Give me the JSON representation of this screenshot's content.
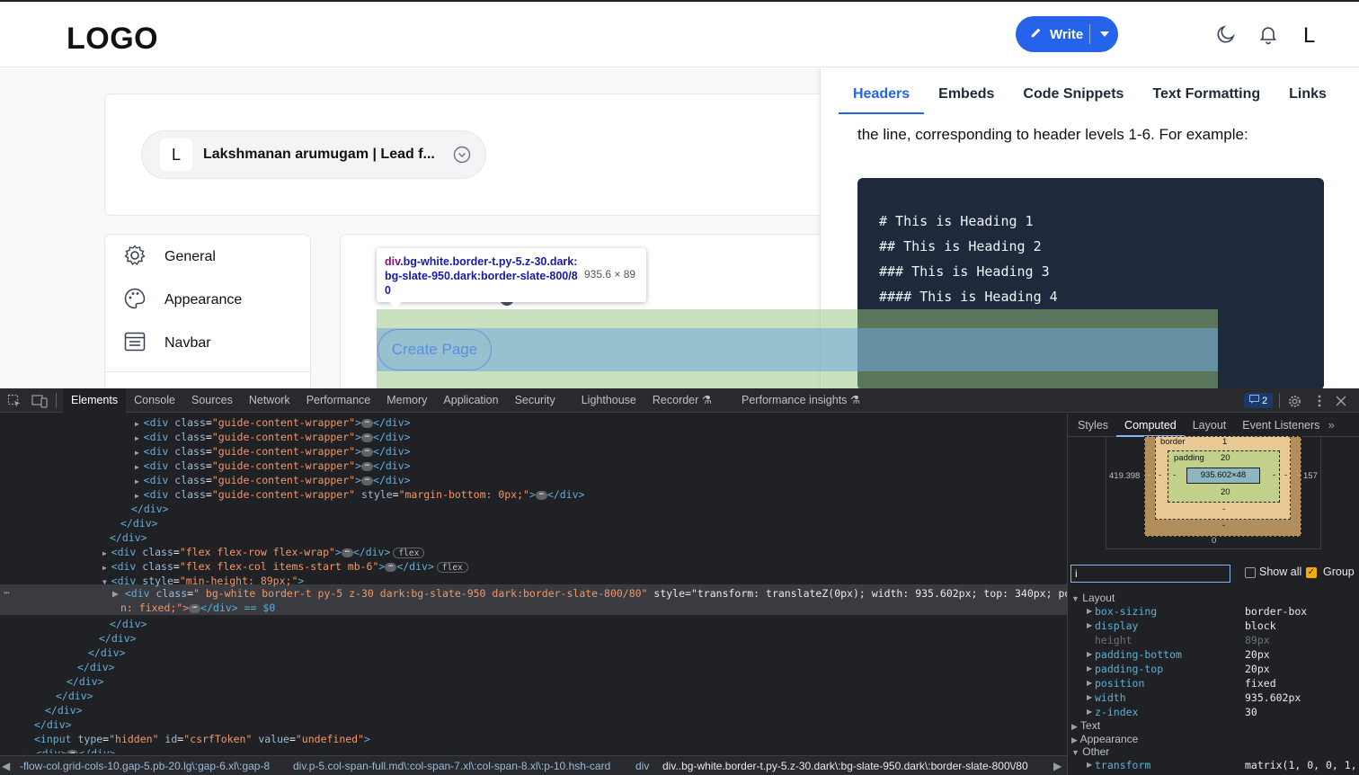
{
  "header": {
    "logo": "LOGO",
    "write_label": "Write",
    "avatar_letter": "L",
    "icons": [
      "pencil-icon",
      "caret-down-icon",
      "moon-icon",
      "bell-icon"
    ]
  },
  "profile": {
    "avatar_letter": "L",
    "name": "Lakshmanan arumugam | Lead f..."
  },
  "settings_nav": {
    "items": [
      {
        "label": "General",
        "icon": "gear-icon"
      },
      {
        "label": "Appearance",
        "icon": "palette-icon"
      },
      {
        "label": "Navbar",
        "icon": "navbar-icon"
      }
    ]
  },
  "guide": {
    "tabs": [
      "Headers",
      "Embeds",
      "Code Snippets",
      "Text Formatting",
      "Links"
    ],
    "active_tab": "Headers",
    "text": "the line, corresponding to header levels 1-6. For example:",
    "code_lines": [
      "# This is Heading 1",
      "## This is Heading 2",
      "### This is Heading 3",
      "#### This is Heading 4"
    ]
  },
  "inspect": {
    "create_page_label": "Create Page",
    "tooltip_tag": "div",
    "tooltip_classes": ".bg-white.border-t.py-5.z-30.dark:bg-slate-950.dark:border-slate-800/80",
    "tooltip_dims": "935.6 × 89"
  },
  "devtools": {
    "tabs": [
      "Elements",
      "Console",
      "Sources",
      "Network",
      "Performance",
      "Memory",
      "Application",
      "Security",
      "Lighthouse",
      "Recorder",
      "Performance insights"
    ],
    "active_tab": "Elements",
    "issues_count": "2",
    "dom_lines": [
      {
        "ind": 150,
        "tri": "▶",
        "html": "<div class=\"guide-content-wrapper\">",
        "ell": true,
        "close": "</div>"
      },
      {
        "ind": 150,
        "tri": "▶",
        "html": "<div class=\"guide-content-wrapper\">",
        "ell": true,
        "close": "</div>"
      },
      {
        "ind": 150,
        "tri": "▶",
        "html": "<div class=\"guide-content-wrapper\">",
        "ell": true,
        "close": "</div>"
      },
      {
        "ind": 150,
        "tri": "▶",
        "html": "<div class=\"guide-content-wrapper\">",
        "ell": true,
        "close": "</div>"
      },
      {
        "ind": 150,
        "tri": "▶",
        "html": "<div class=\"guide-content-wrapper\">",
        "ell": true,
        "close": "</div>"
      },
      {
        "ind": 150,
        "tri": "▶",
        "html": "<div class=\"guide-content-wrapper\" style=\"margin-bottom: 0px;\">",
        "ell": true,
        "close": "</div>"
      },
      {
        "ind": 146,
        "tri": "",
        "html": "</div>",
        "ell": false,
        "close": ""
      },
      {
        "ind": 134,
        "tri": "",
        "html": "</div>",
        "ell": false,
        "close": ""
      },
      {
        "ind": 122,
        "tri": "",
        "html": "</div>",
        "ell": false,
        "close": ""
      },
      {
        "ind": 114,
        "tri": "▶",
        "html": "<div class=\"flex flex-row flex-wrap\">",
        "ell": true,
        "close": "</div>",
        "pill": "flex"
      },
      {
        "ind": 114,
        "tri": "▶",
        "html": "<div class=\"flex flex-col items-start mb-6\">",
        "ell": true,
        "close": "</div>",
        "pill": "flex"
      },
      {
        "ind": 114,
        "tri": "▼",
        "html": "<div style=\"min-height: 89px;\">",
        "ell": false,
        "close": ""
      }
    ],
    "selected_line_1": "<div class=\" bg-white border-t py-5 z-30 dark:bg-slate-950 dark:border-slate-800/80\" style=\"transform: translateZ(0px); width: 935.602px; top: 340px; positio",
    "selected_line_2": "n: fixed;\">",
    "selected_suffix": "</div> == $0",
    "after_lines": [
      {
        "ind": 122,
        "html": "</div>"
      },
      {
        "ind": 110,
        "html": "</div>"
      },
      {
        "ind": 98,
        "html": "</div>"
      },
      {
        "ind": 86,
        "html": "</div>"
      },
      {
        "ind": 74,
        "html": "</div>"
      },
      {
        "ind": 62,
        "html": "</div>"
      },
      {
        "ind": 50,
        "html": "</div>"
      },
      {
        "ind": 38,
        "html": "</div>"
      },
      {
        "ind": 38,
        "html": "<input type=\"hidden\" id=\"csrfToken\" value=\"undefined\">"
      },
      {
        "ind": 30,
        "html": "<div>",
        "ell": true,
        "close": "</div>",
        "tri": "▶"
      }
    ],
    "breadcrumbs": [
      "-flow-col.grid-cols-10.gap-5.pb-20.lg\\:gap-6.xl\\:gap-8",
      "div.p-5.col-span-full.md\\:col-span-7.xl\\:col-span-8.xl\\:p-10.hsh-card",
      "div",
      "div..bg-white.border-t.py-5.z-30.dark\\:bg-slate-950.dark\\:border-slate-800\\/80"
    ],
    "side_tabs": [
      "Styles",
      "Computed",
      "Layout",
      "Event Listeners"
    ],
    "side_active": "Computed",
    "box_model": {
      "border_label": "border",
      "border_value": "1",
      "padding_label": "padding",
      "padding_top": "20",
      "padding_bottom": "20",
      "content": "935.602×48",
      "left": "419.398",
      "right": "157",
      "bottom": "0",
      "dash": "-"
    },
    "filter_value": "i",
    "show_all_label": "Show all",
    "group_label": "Group",
    "groups": {
      "layout": "Layout",
      "text": "Text",
      "appearance": "Appearance",
      "other": "Other"
    },
    "layout_props": [
      {
        "name": "box-sizing",
        "value": "border-box",
        "dim": false
      },
      {
        "name": "display",
        "value": "block",
        "dim": false
      },
      {
        "name": "height",
        "value": "89px",
        "dim": true
      },
      {
        "name": "padding-bottom",
        "value": "20px",
        "dim": false
      },
      {
        "name": "padding-top",
        "value": "20px",
        "dim": false
      },
      {
        "name": "position",
        "value": "fixed",
        "dim": false
      },
      {
        "name": "width",
        "value": "935.602px",
        "dim": false
      },
      {
        "name": "z-index",
        "value": "30",
        "dim": false
      }
    ],
    "other_props": [
      {
        "name": "transform",
        "value": "matrix(1, 0, 0, 1,",
        "dim": false
      }
    ]
  }
}
